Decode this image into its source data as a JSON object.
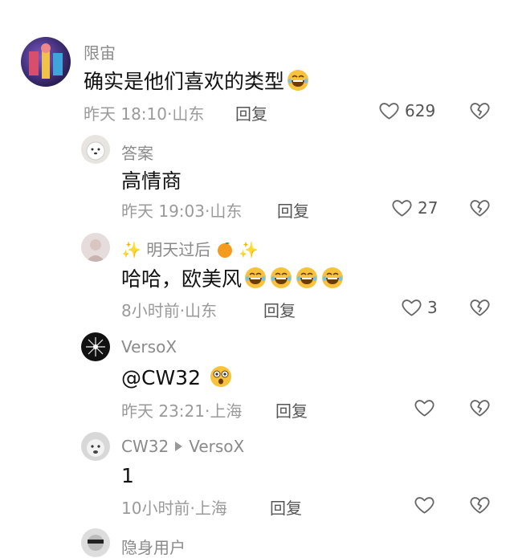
{
  "comments": [
    {
      "username": "限宙",
      "text": "确实是他们喜欢的类型",
      "time": "昨天 18:10",
      "location": "山东",
      "reply": "回复",
      "likes": "629"
    },
    {
      "username": "答案",
      "text": "高情商",
      "time": "昨天 19:03",
      "location": "山东",
      "reply": "回复",
      "likes": "27"
    },
    {
      "username": "明天过后",
      "text": "哈哈，欧美风",
      "time": "8小时前",
      "location": "山东",
      "reply": "回复",
      "likes": "3"
    },
    {
      "username": "VersoX",
      "text": "@CW32",
      "time": "昨天 23:21",
      "location": "上海",
      "reply": "回复",
      "likes": ""
    },
    {
      "username": "CW32",
      "reply_to": "VersoX",
      "text": "1",
      "time": "10小时前",
      "location": "上海",
      "reply": "回复",
      "likes": ""
    },
    {
      "username": "隐身用户"
    }
  ],
  "separator": "·",
  "colors": {
    "meta": "#9a9a9a",
    "username": "#8a8a8a",
    "text": "#111111",
    "emoji": "#f7c23c"
  }
}
